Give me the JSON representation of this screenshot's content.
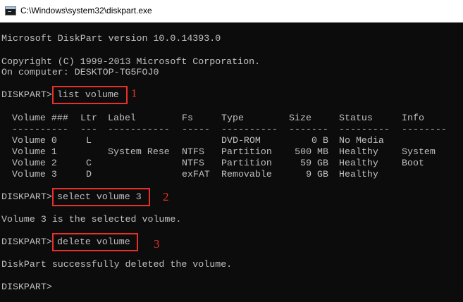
{
  "window": {
    "title": "C:\\Windows\\system32\\diskpart.exe"
  },
  "console": {
    "version_line": "Microsoft DiskPart version 10.0.14393.0",
    "copyright_line": "Copyright (C) 1999-2013 Microsoft Corporation.",
    "computer_line": "On computer: DESKTOP-TG5FOJ0",
    "prompt": "DISKPART>",
    "commands": [
      "list volume",
      "select volume 3",
      "delete volume"
    ],
    "select_result": "Volume 3 is the selected volume.",
    "delete_result": "DiskPart successfully deleted the volume."
  },
  "volume_table": {
    "columns": [
      "Volume ###",
      "Ltr",
      "Label",
      "Fs",
      "Type",
      "Size",
      "Status",
      "Info"
    ],
    "separators": [
      "----------",
      "---",
      "-----------",
      "-----",
      "----------",
      "-------",
      "---------",
      "--------"
    ],
    "rows": [
      [
        "Volume 0",
        "L",
        "",
        "",
        "DVD-ROM",
        "0 B",
        "No Media",
        ""
      ],
      [
        "Volume 1",
        "",
        "System Rese",
        "NTFS",
        "Partition",
        "500 MB",
        "Healthy",
        "System"
      ],
      [
        "Volume 2",
        "C",
        "",
        "NTFS",
        "Partition",
        "59 GB",
        "Healthy",
        "Boot"
      ],
      [
        "Volume 3",
        "D",
        "",
        "exFAT",
        "Removable",
        "9 GB",
        "Healthy",
        ""
      ]
    ]
  },
  "annotations": {
    "step_numbers": [
      "1",
      "2",
      "3"
    ],
    "highlight_color": "#e8302a"
  },
  "colors": {
    "console_bg": "#0c0c0c",
    "console_text": "#c0c0c0",
    "titlebar_bg": "#ffffff"
  }
}
